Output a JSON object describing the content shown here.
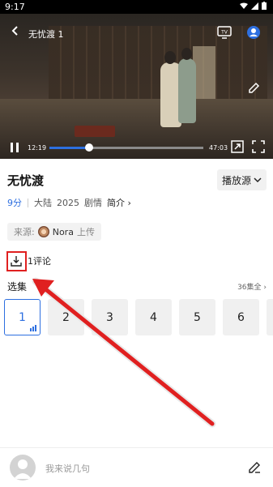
{
  "status": {
    "time": "9:17"
  },
  "player": {
    "title": "无忧渡 1",
    "current_time": "12:19",
    "total_time": "47:03",
    "progress": 0.26
  },
  "show": {
    "title": "无忧渡",
    "source_button": "播放源",
    "score": "9分",
    "region": "大陆",
    "year": "2025",
    "genre": "剧情",
    "intro": "简介"
  },
  "uploader": {
    "prefix": "来源:",
    "name": "Nora",
    "suffix": "上传"
  },
  "comments": {
    "label": "评论",
    "count": "1"
  },
  "episodes": {
    "label": "选集",
    "total": "36集全",
    "items": [
      "1",
      "2",
      "3",
      "4",
      "5",
      "6"
    ]
  },
  "bottom": {
    "placeholder": "我来说几句"
  },
  "colors": {
    "accent": "#2d6fe0",
    "annotation": "#e02020"
  }
}
